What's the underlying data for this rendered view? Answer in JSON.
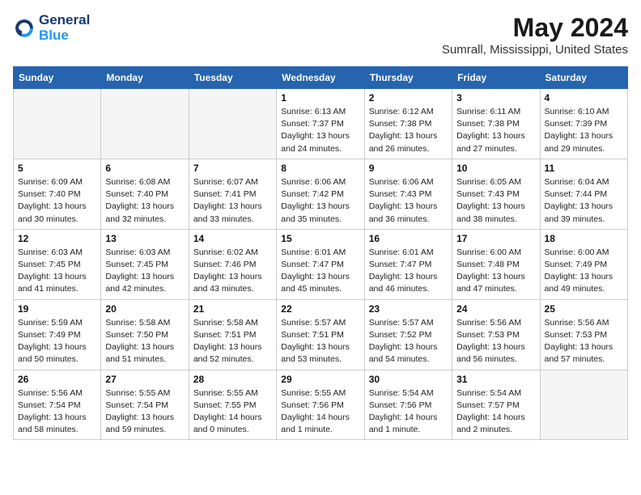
{
  "logo": {
    "line1": "General",
    "line2": "Blue"
  },
  "title": "May 2024",
  "location": "Sumrall, Mississippi, United States",
  "weekdays": [
    "Sunday",
    "Monday",
    "Tuesday",
    "Wednesday",
    "Thursday",
    "Friday",
    "Saturday"
  ],
  "weeks": [
    [
      {
        "day": "",
        "info": ""
      },
      {
        "day": "",
        "info": ""
      },
      {
        "day": "",
        "info": ""
      },
      {
        "day": "1",
        "info": "Sunrise: 6:13 AM\nSunset: 7:37 PM\nDaylight: 13 hours\nand 24 minutes."
      },
      {
        "day": "2",
        "info": "Sunrise: 6:12 AM\nSunset: 7:38 PM\nDaylight: 13 hours\nand 26 minutes."
      },
      {
        "day": "3",
        "info": "Sunrise: 6:11 AM\nSunset: 7:38 PM\nDaylight: 13 hours\nand 27 minutes."
      },
      {
        "day": "4",
        "info": "Sunrise: 6:10 AM\nSunset: 7:39 PM\nDaylight: 13 hours\nand 29 minutes."
      }
    ],
    [
      {
        "day": "5",
        "info": "Sunrise: 6:09 AM\nSunset: 7:40 PM\nDaylight: 13 hours\nand 30 minutes."
      },
      {
        "day": "6",
        "info": "Sunrise: 6:08 AM\nSunset: 7:40 PM\nDaylight: 13 hours\nand 32 minutes."
      },
      {
        "day": "7",
        "info": "Sunrise: 6:07 AM\nSunset: 7:41 PM\nDaylight: 13 hours\nand 33 minutes."
      },
      {
        "day": "8",
        "info": "Sunrise: 6:06 AM\nSunset: 7:42 PM\nDaylight: 13 hours\nand 35 minutes."
      },
      {
        "day": "9",
        "info": "Sunrise: 6:06 AM\nSunset: 7:43 PM\nDaylight: 13 hours\nand 36 minutes."
      },
      {
        "day": "10",
        "info": "Sunrise: 6:05 AM\nSunset: 7:43 PM\nDaylight: 13 hours\nand 38 minutes."
      },
      {
        "day": "11",
        "info": "Sunrise: 6:04 AM\nSunset: 7:44 PM\nDaylight: 13 hours\nand 39 minutes."
      }
    ],
    [
      {
        "day": "12",
        "info": "Sunrise: 6:03 AM\nSunset: 7:45 PM\nDaylight: 13 hours\nand 41 minutes."
      },
      {
        "day": "13",
        "info": "Sunrise: 6:03 AM\nSunset: 7:45 PM\nDaylight: 13 hours\nand 42 minutes."
      },
      {
        "day": "14",
        "info": "Sunrise: 6:02 AM\nSunset: 7:46 PM\nDaylight: 13 hours\nand 43 minutes."
      },
      {
        "day": "15",
        "info": "Sunrise: 6:01 AM\nSunset: 7:47 PM\nDaylight: 13 hours\nand 45 minutes."
      },
      {
        "day": "16",
        "info": "Sunrise: 6:01 AM\nSunset: 7:47 PM\nDaylight: 13 hours\nand 46 minutes."
      },
      {
        "day": "17",
        "info": "Sunrise: 6:00 AM\nSunset: 7:48 PM\nDaylight: 13 hours\nand 47 minutes."
      },
      {
        "day": "18",
        "info": "Sunrise: 6:00 AM\nSunset: 7:49 PM\nDaylight: 13 hours\nand 49 minutes."
      }
    ],
    [
      {
        "day": "19",
        "info": "Sunrise: 5:59 AM\nSunset: 7:49 PM\nDaylight: 13 hours\nand 50 minutes."
      },
      {
        "day": "20",
        "info": "Sunrise: 5:58 AM\nSunset: 7:50 PM\nDaylight: 13 hours\nand 51 minutes."
      },
      {
        "day": "21",
        "info": "Sunrise: 5:58 AM\nSunset: 7:51 PM\nDaylight: 13 hours\nand 52 minutes."
      },
      {
        "day": "22",
        "info": "Sunrise: 5:57 AM\nSunset: 7:51 PM\nDaylight: 13 hours\nand 53 minutes."
      },
      {
        "day": "23",
        "info": "Sunrise: 5:57 AM\nSunset: 7:52 PM\nDaylight: 13 hours\nand 54 minutes."
      },
      {
        "day": "24",
        "info": "Sunrise: 5:56 AM\nSunset: 7:53 PM\nDaylight: 13 hours\nand 56 minutes."
      },
      {
        "day": "25",
        "info": "Sunrise: 5:56 AM\nSunset: 7:53 PM\nDaylight: 13 hours\nand 57 minutes."
      }
    ],
    [
      {
        "day": "26",
        "info": "Sunrise: 5:56 AM\nSunset: 7:54 PM\nDaylight: 13 hours\nand 58 minutes."
      },
      {
        "day": "27",
        "info": "Sunrise: 5:55 AM\nSunset: 7:54 PM\nDaylight: 13 hours\nand 59 minutes."
      },
      {
        "day": "28",
        "info": "Sunrise: 5:55 AM\nSunset: 7:55 PM\nDaylight: 14 hours\nand 0 minutes."
      },
      {
        "day": "29",
        "info": "Sunrise: 5:55 AM\nSunset: 7:56 PM\nDaylight: 14 hours\nand 1 minute."
      },
      {
        "day": "30",
        "info": "Sunrise: 5:54 AM\nSunset: 7:56 PM\nDaylight: 14 hours\nand 1 minute."
      },
      {
        "day": "31",
        "info": "Sunrise: 5:54 AM\nSunset: 7:57 PM\nDaylight: 14 hours\nand 2 minutes."
      },
      {
        "day": "",
        "info": ""
      }
    ]
  ]
}
